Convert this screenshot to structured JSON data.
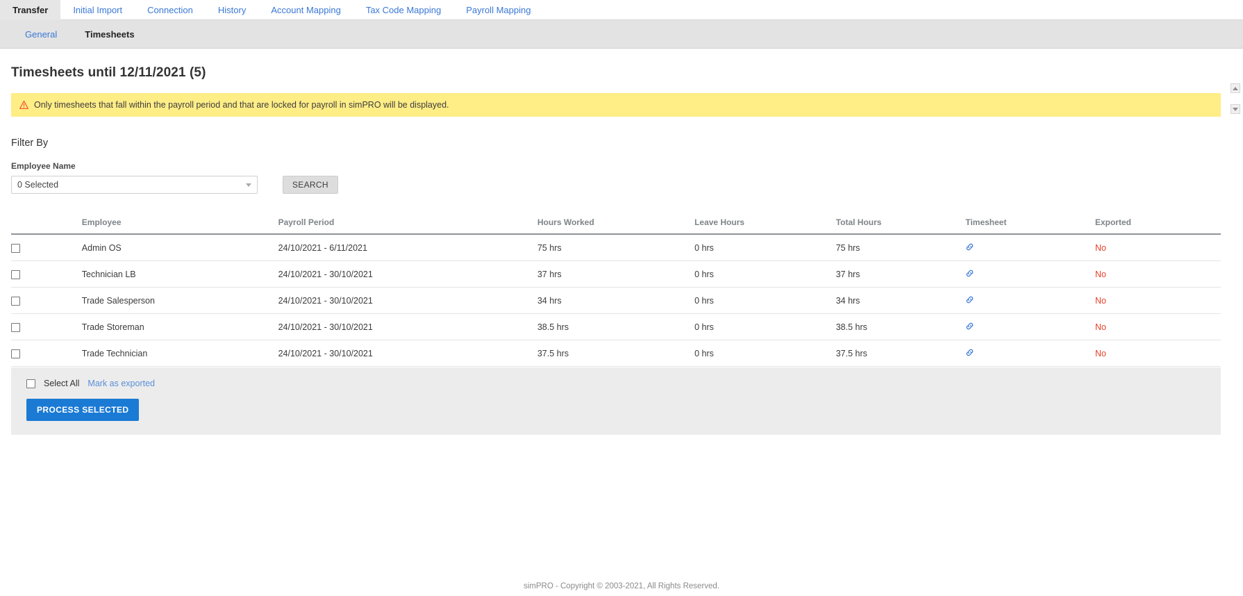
{
  "tabs": {
    "items": [
      {
        "label": "Transfer",
        "active": true
      },
      {
        "label": "Initial Import",
        "active": false
      },
      {
        "label": "Connection",
        "active": false
      },
      {
        "label": "History",
        "active": false
      },
      {
        "label": "Account Mapping",
        "active": false
      },
      {
        "label": "Tax Code Mapping",
        "active": false
      },
      {
        "label": "Payroll Mapping",
        "active": false
      }
    ]
  },
  "subtabs": {
    "items": [
      {
        "label": "General",
        "active": false
      },
      {
        "label": "Timesheets",
        "active": true
      }
    ]
  },
  "page": {
    "title": "Timesheets until 12/11/2021 (5)",
    "alert": "Only timesheets that fall within the payroll period and that are locked for payroll in simPRO will be displayed."
  },
  "filter": {
    "heading": "Filter By",
    "employee_label": "Employee Name",
    "employee_value": "0 Selected",
    "search_label": "SEARCH"
  },
  "table": {
    "columns": [
      "",
      "Employee",
      "Payroll Period",
      "Hours Worked",
      "Leave Hours",
      "Total Hours",
      "Timesheet",
      "Exported"
    ],
    "rows": [
      {
        "employee": "Admin OS",
        "payroll_period": "24/10/2021 - 6/11/2021",
        "hours_worked": "75 hrs",
        "leave_hours": "0 hrs",
        "total_hours": "75 hrs",
        "timesheet_icon": "link-icon",
        "exported": "No",
        "checked": false
      },
      {
        "employee": "Technician LB",
        "payroll_period": "24/10/2021 - 30/10/2021",
        "hours_worked": "37 hrs",
        "leave_hours": "0 hrs",
        "total_hours": "37 hrs",
        "timesheet_icon": "link-icon",
        "exported": "No",
        "checked": false
      },
      {
        "employee": "Trade Salesperson",
        "payroll_period": "24/10/2021 - 30/10/2021",
        "hours_worked": "34 hrs",
        "leave_hours": "0 hrs",
        "total_hours": "34 hrs",
        "timesheet_icon": "link-icon",
        "exported": "No",
        "checked": false
      },
      {
        "employee": "Trade Storeman",
        "payroll_period": "24/10/2021 - 30/10/2021",
        "hours_worked": "38.5 hrs",
        "leave_hours": "0 hrs",
        "total_hours": "38.5 hrs",
        "timesheet_icon": "link-icon",
        "exported": "No",
        "checked": false
      },
      {
        "employee": "Trade Technician",
        "payroll_period": "24/10/2021 - 30/10/2021",
        "hours_worked": "37.5 hrs",
        "leave_hours": "0 hrs",
        "total_hours": "37.5 hrs",
        "timesheet_icon": "link-icon",
        "exported": "No",
        "checked": false
      }
    ]
  },
  "actions": {
    "select_all_label": "Select All",
    "mark_as_exported_label": "Mark as exported",
    "process_selected_label": "PROCESS SELECTED"
  },
  "footer": {
    "copyright": "simPRO - Copyright © 2003-2021, All Rights Reserved."
  },
  "colors": {
    "link": "#3a78d6",
    "primary_button": "#1a7ad4",
    "alert_background": "#ffed86",
    "exported_no": "#e8402a"
  }
}
